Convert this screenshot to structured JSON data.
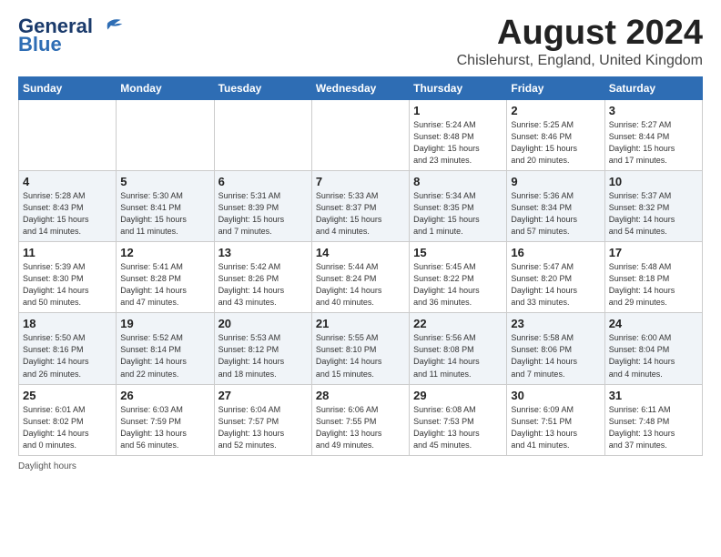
{
  "header": {
    "logo_line1": "General",
    "logo_line2": "Blue",
    "month_title": "August 2024",
    "location": "Chislehurst, England, United Kingdom"
  },
  "days_of_week": [
    "Sunday",
    "Monday",
    "Tuesday",
    "Wednesday",
    "Thursday",
    "Friday",
    "Saturday"
  ],
  "weeks": [
    [
      {
        "day": "",
        "info": ""
      },
      {
        "day": "",
        "info": ""
      },
      {
        "day": "",
        "info": ""
      },
      {
        "day": "",
        "info": ""
      },
      {
        "day": "1",
        "info": "Sunrise: 5:24 AM\nSunset: 8:48 PM\nDaylight: 15 hours\nand 23 minutes."
      },
      {
        "day": "2",
        "info": "Sunrise: 5:25 AM\nSunset: 8:46 PM\nDaylight: 15 hours\nand 20 minutes."
      },
      {
        "day": "3",
        "info": "Sunrise: 5:27 AM\nSunset: 8:44 PM\nDaylight: 15 hours\nand 17 minutes."
      }
    ],
    [
      {
        "day": "4",
        "info": "Sunrise: 5:28 AM\nSunset: 8:43 PM\nDaylight: 15 hours\nand 14 minutes."
      },
      {
        "day": "5",
        "info": "Sunrise: 5:30 AM\nSunset: 8:41 PM\nDaylight: 15 hours\nand 11 minutes."
      },
      {
        "day": "6",
        "info": "Sunrise: 5:31 AM\nSunset: 8:39 PM\nDaylight: 15 hours\nand 7 minutes."
      },
      {
        "day": "7",
        "info": "Sunrise: 5:33 AM\nSunset: 8:37 PM\nDaylight: 15 hours\nand 4 minutes."
      },
      {
        "day": "8",
        "info": "Sunrise: 5:34 AM\nSunset: 8:35 PM\nDaylight: 15 hours\nand 1 minute."
      },
      {
        "day": "9",
        "info": "Sunrise: 5:36 AM\nSunset: 8:34 PM\nDaylight: 14 hours\nand 57 minutes."
      },
      {
        "day": "10",
        "info": "Sunrise: 5:37 AM\nSunset: 8:32 PM\nDaylight: 14 hours\nand 54 minutes."
      }
    ],
    [
      {
        "day": "11",
        "info": "Sunrise: 5:39 AM\nSunset: 8:30 PM\nDaylight: 14 hours\nand 50 minutes."
      },
      {
        "day": "12",
        "info": "Sunrise: 5:41 AM\nSunset: 8:28 PM\nDaylight: 14 hours\nand 47 minutes."
      },
      {
        "day": "13",
        "info": "Sunrise: 5:42 AM\nSunset: 8:26 PM\nDaylight: 14 hours\nand 43 minutes."
      },
      {
        "day": "14",
        "info": "Sunrise: 5:44 AM\nSunset: 8:24 PM\nDaylight: 14 hours\nand 40 minutes."
      },
      {
        "day": "15",
        "info": "Sunrise: 5:45 AM\nSunset: 8:22 PM\nDaylight: 14 hours\nand 36 minutes."
      },
      {
        "day": "16",
        "info": "Sunrise: 5:47 AM\nSunset: 8:20 PM\nDaylight: 14 hours\nand 33 minutes."
      },
      {
        "day": "17",
        "info": "Sunrise: 5:48 AM\nSunset: 8:18 PM\nDaylight: 14 hours\nand 29 minutes."
      }
    ],
    [
      {
        "day": "18",
        "info": "Sunrise: 5:50 AM\nSunset: 8:16 PM\nDaylight: 14 hours\nand 26 minutes."
      },
      {
        "day": "19",
        "info": "Sunrise: 5:52 AM\nSunset: 8:14 PM\nDaylight: 14 hours\nand 22 minutes."
      },
      {
        "day": "20",
        "info": "Sunrise: 5:53 AM\nSunset: 8:12 PM\nDaylight: 14 hours\nand 18 minutes."
      },
      {
        "day": "21",
        "info": "Sunrise: 5:55 AM\nSunset: 8:10 PM\nDaylight: 14 hours\nand 15 minutes."
      },
      {
        "day": "22",
        "info": "Sunrise: 5:56 AM\nSunset: 8:08 PM\nDaylight: 14 hours\nand 11 minutes."
      },
      {
        "day": "23",
        "info": "Sunrise: 5:58 AM\nSunset: 8:06 PM\nDaylight: 14 hours\nand 7 minutes."
      },
      {
        "day": "24",
        "info": "Sunrise: 6:00 AM\nSunset: 8:04 PM\nDaylight: 14 hours\nand 4 minutes."
      }
    ],
    [
      {
        "day": "25",
        "info": "Sunrise: 6:01 AM\nSunset: 8:02 PM\nDaylight: 14 hours\nand 0 minutes."
      },
      {
        "day": "26",
        "info": "Sunrise: 6:03 AM\nSunset: 7:59 PM\nDaylight: 13 hours\nand 56 minutes."
      },
      {
        "day": "27",
        "info": "Sunrise: 6:04 AM\nSunset: 7:57 PM\nDaylight: 13 hours\nand 52 minutes."
      },
      {
        "day": "28",
        "info": "Sunrise: 6:06 AM\nSunset: 7:55 PM\nDaylight: 13 hours\nand 49 minutes."
      },
      {
        "day": "29",
        "info": "Sunrise: 6:08 AM\nSunset: 7:53 PM\nDaylight: 13 hours\nand 45 minutes."
      },
      {
        "day": "30",
        "info": "Sunrise: 6:09 AM\nSunset: 7:51 PM\nDaylight: 13 hours\nand 41 minutes."
      },
      {
        "day": "31",
        "info": "Sunrise: 6:11 AM\nSunset: 7:48 PM\nDaylight: 13 hours\nand 37 minutes."
      }
    ]
  ],
  "footer": {
    "daylight_label": "Daylight hours"
  }
}
